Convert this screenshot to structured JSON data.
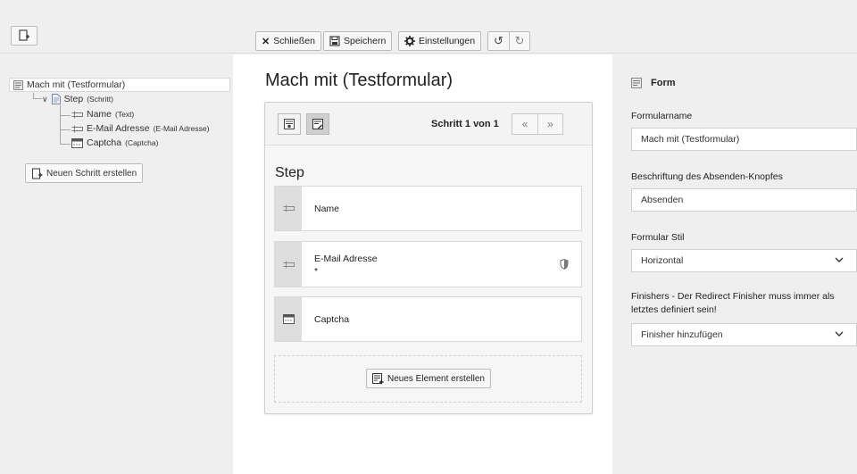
{
  "toolbar": {
    "close_label": "Schließen",
    "save_label": "Speichern",
    "settings_label": "Einstellungen"
  },
  "tree": {
    "root_label": "Mach mit (Testformular)",
    "step": {
      "label": "Step",
      "type": "(Schritt)"
    },
    "items": [
      {
        "label": "Name",
        "type": "(Text)"
      },
      {
        "label": "E-Mail Adresse",
        "type": "(E-Mail Adresse)"
      },
      {
        "label": "Captcha",
        "type": "(Captcha)"
      }
    ],
    "new_step_label": "Neuen Schritt erstellen"
  },
  "stage": {
    "title": "Mach mit (Testformular)",
    "step_count": "Schritt 1 von 1",
    "prev_symbol": "«",
    "next_symbol": "»",
    "step_title": "Step",
    "elements": [
      {
        "label": "Name",
        "required": ""
      },
      {
        "label": "E-Mail Adresse",
        "required": "*"
      },
      {
        "label": "Captcha",
        "required": ""
      }
    ],
    "new_element_label": "Neues Element erstellen"
  },
  "inspector": {
    "header": "Form",
    "form_name_label": "Formularname",
    "form_name_value": "Mach mit (Testformular)",
    "submit_label_label": "Beschriftung des Absenden-Knopfes",
    "submit_label_value": "Absenden",
    "style_label": "Formular Stil",
    "style_value": "Horizontal",
    "finishers_label": "Finishers - Der Redirect Finisher muss immer als letztes definiert sein!",
    "finishers_value": "Finisher hinzufügen"
  },
  "icons": {
    "new_form": "new-form-icon",
    "close": "close-icon",
    "save": "save-icon",
    "settings": "gear-icon",
    "undo": "undo-icon",
    "redo": "redo-icon",
    "text_field": "text-field-icon",
    "captcha": "captcha-icon",
    "shield": "shield-icon"
  }
}
